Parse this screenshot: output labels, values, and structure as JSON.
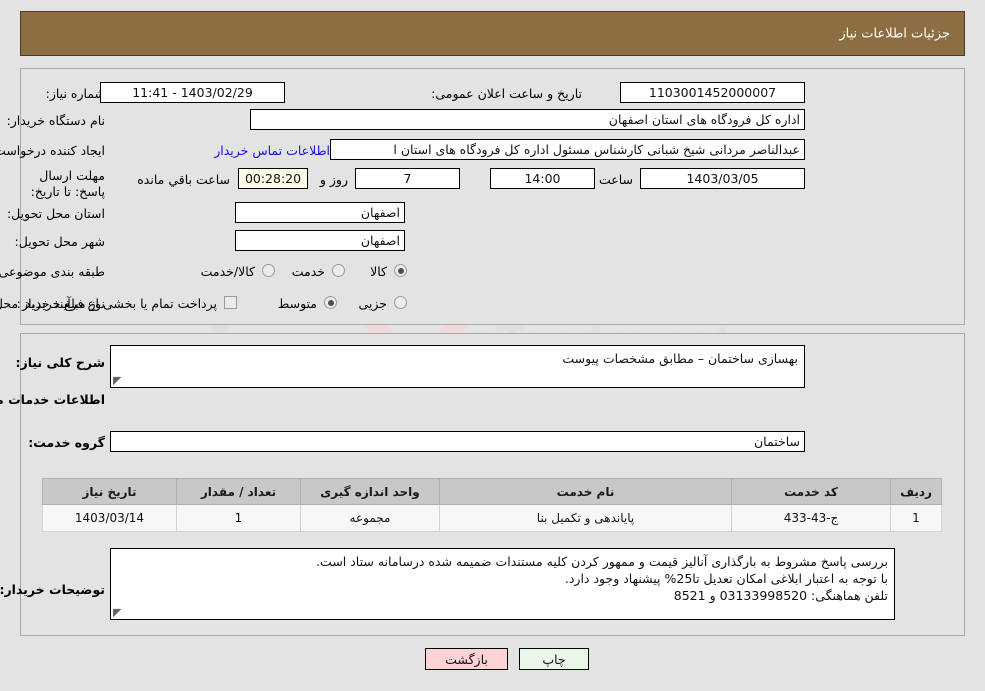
{
  "header": {
    "title": "جزئیات اطلاعات نیاز"
  },
  "watermark": {
    "text1": "Ar",
    "text2": "aTender.net"
  },
  "form": {
    "need_number_label": "شماره نیاز:",
    "need_number_value": "1103001452000007",
    "public_announce_label": "تاریخ و ساعت اعلان عمومی:",
    "public_announce_value": "1403/02/29 - 11:41",
    "buyer_org_label": "نام دستگاه خریدار:",
    "buyer_org_value": "اداره کل فرودگاه های استان اصفهان",
    "creator_label": "ایجاد کننده درخواست:",
    "creator_value": "عبدالناصر مردانی شیخ شبانی کارشناس مسئول  اداره کل فرودگاه های استان ا",
    "contact_link": "اطلاعات تماس خریدار",
    "deadline_label": "مهلت ارسال پاسخ: تا تاریخ:",
    "deadline_date": "1403/03/05",
    "hour_label": "ساعت",
    "deadline_time": "14:00",
    "days_value": "7",
    "days_label": "روز و",
    "countdown_value": "00:28:20",
    "countdown_label": "ساعت باقي مانده",
    "delivery_province_label": "استان محل تحویل:",
    "delivery_province_value": "اصفهان",
    "delivery_city_label": "شهر محل تحویل:",
    "delivery_city_value": "اصفهان",
    "category_label": "طبقه بندی موضوعی:",
    "category_options": [
      "کالا",
      "خدمت",
      "کالا/خدمت"
    ],
    "category_selected": "خدمت",
    "process_label": "نوع فرآیند خرید :",
    "process_options": [
      "جزیی",
      "متوسط"
    ],
    "process_selected": "متوسط",
    "treasury_checkbox_label": "پرداخت تمام یا بخشی از مبلغ خرید،از محل \"اسناد خزانه اسلامی\" خواهد بود.",
    "treasury_checked": false
  },
  "description": {
    "need_summary_label": "شرح کلی نیاز:",
    "need_summary_value": "بهسازی ساختمان – مطابق مشخصات پیوست",
    "services_heading": "اطلاعات خدمات مورد نیاز",
    "service_group_label": "گروه خدمت:",
    "service_group_value": "ساختمان"
  },
  "table": {
    "columns": [
      "ردیف",
      "کد خدمت",
      "نام خدمت",
      "واحد اندازه گیری",
      "تعداد / مقدار",
      "تاریخ نیاز"
    ],
    "rows": [
      {
        "index": "1",
        "service_code": "ج-43-433",
        "service_name": "پایاندهی و تکمیل بنا",
        "unit": "مجموعه",
        "quantity": "1",
        "need_date": "1403/03/14"
      }
    ]
  },
  "buyer_notes": {
    "label": "توضیحات خریدار:",
    "lines": [
      "بررسی پاسخ مشروط  به بارگذاری آنالیز قیمت و ممهور کردن کلیه مستندات ضمیمه شده درسامانه  ستاد است.",
      "با توجه به اعتبار ابلاغی امکان تعدیل تا25% پیشنهاد وجود دارد.",
      "تلفن هماهنگی: 03133998520 و 8521"
    ]
  },
  "buttons": {
    "print": "چاپ",
    "back": "بازگشت"
  },
  "colors": {
    "header_bg": "#8d6e43",
    "page_bg": "#e3e3e3",
    "link": "#1414cf",
    "table_header_bg": "#c8c8c8",
    "print_btn_bg": "#e9f7e9",
    "back_btn_bg": "#fbd3d3",
    "countdown_bg": "#fbfbe8"
  }
}
